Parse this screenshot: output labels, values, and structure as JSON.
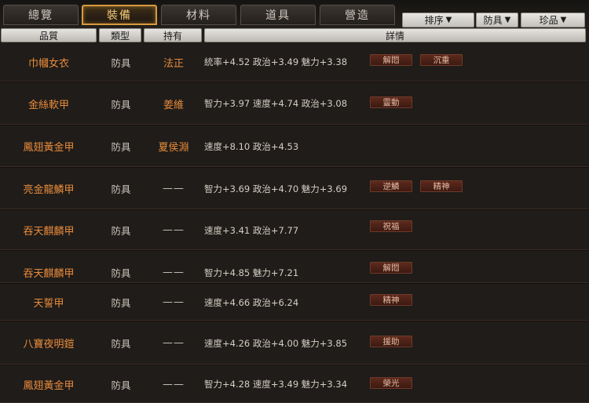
{
  "tabs": [
    {
      "label": "總覽",
      "active": false
    },
    {
      "label": "裝備",
      "active": true
    },
    {
      "label": "材料",
      "active": false
    },
    {
      "label": "道具",
      "active": false
    },
    {
      "label": "營造",
      "active": false
    }
  ],
  "dropdowns": [
    {
      "label": "排序"
    },
    {
      "label": "防具"
    },
    {
      "label": "珍品"
    }
  ],
  "columns": [
    "品質",
    "類型",
    "持有",
    "詳情"
  ],
  "rows": [
    {
      "name": "巾幗女衣",
      "type": "防具",
      "owner": "法正",
      "detail": "統率+4.52 政治+3.49 魅力+3.38",
      "tags": [
        "解悶",
        "沉重"
      ]
    },
    {
      "name": "金絲軟甲",
      "type": "防具",
      "owner": "姜維",
      "detail": "智力+3.97 速度+4.74 政治+3.08",
      "tags": [
        "靈動"
      ]
    },
    {
      "name": "鳳翅黃金甲",
      "type": "防具",
      "owner": "夏侯淵",
      "detail": "速度+8.10 政治+4.53",
      "tags": []
    },
    {
      "name": "亮金龍鱗甲",
      "type": "防具",
      "owner": "——",
      "detail": "智力+3.69 政治+4.70 魅力+3.69",
      "tags": [
        "逆鱗",
        "精神"
      ]
    },
    {
      "name": "吞天麒麟甲",
      "type": "防具",
      "owner": "——",
      "detail": "速度+3.41 政治+7.77",
      "tags": [
        "祝福"
      ]
    },
    {
      "name": "吞天麒麟甲",
      "type": "防具",
      "owner": "——",
      "detail": "智力+4.85 魅力+7.21",
      "tags": [
        "解悶"
      ]
    },
    {
      "name": "天誓甲",
      "type": "防具",
      "owner": "——",
      "detail": "速度+4.66 政治+6.24",
      "tags": [
        "精神"
      ]
    },
    {
      "name": "八寶夜明鎧",
      "type": "防具",
      "owner": "——",
      "detail": "速度+4.26 政治+4.00 魅力+3.85",
      "tags": [
        "援助"
      ]
    },
    {
      "name": "鳳翅黃金甲",
      "type": "防具",
      "owner": "——",
      "detail": "智力+4.28 速度+3.49 魅力+3.34",
      "tags": [
        "榮光"
      ]
    }
  ]
}
